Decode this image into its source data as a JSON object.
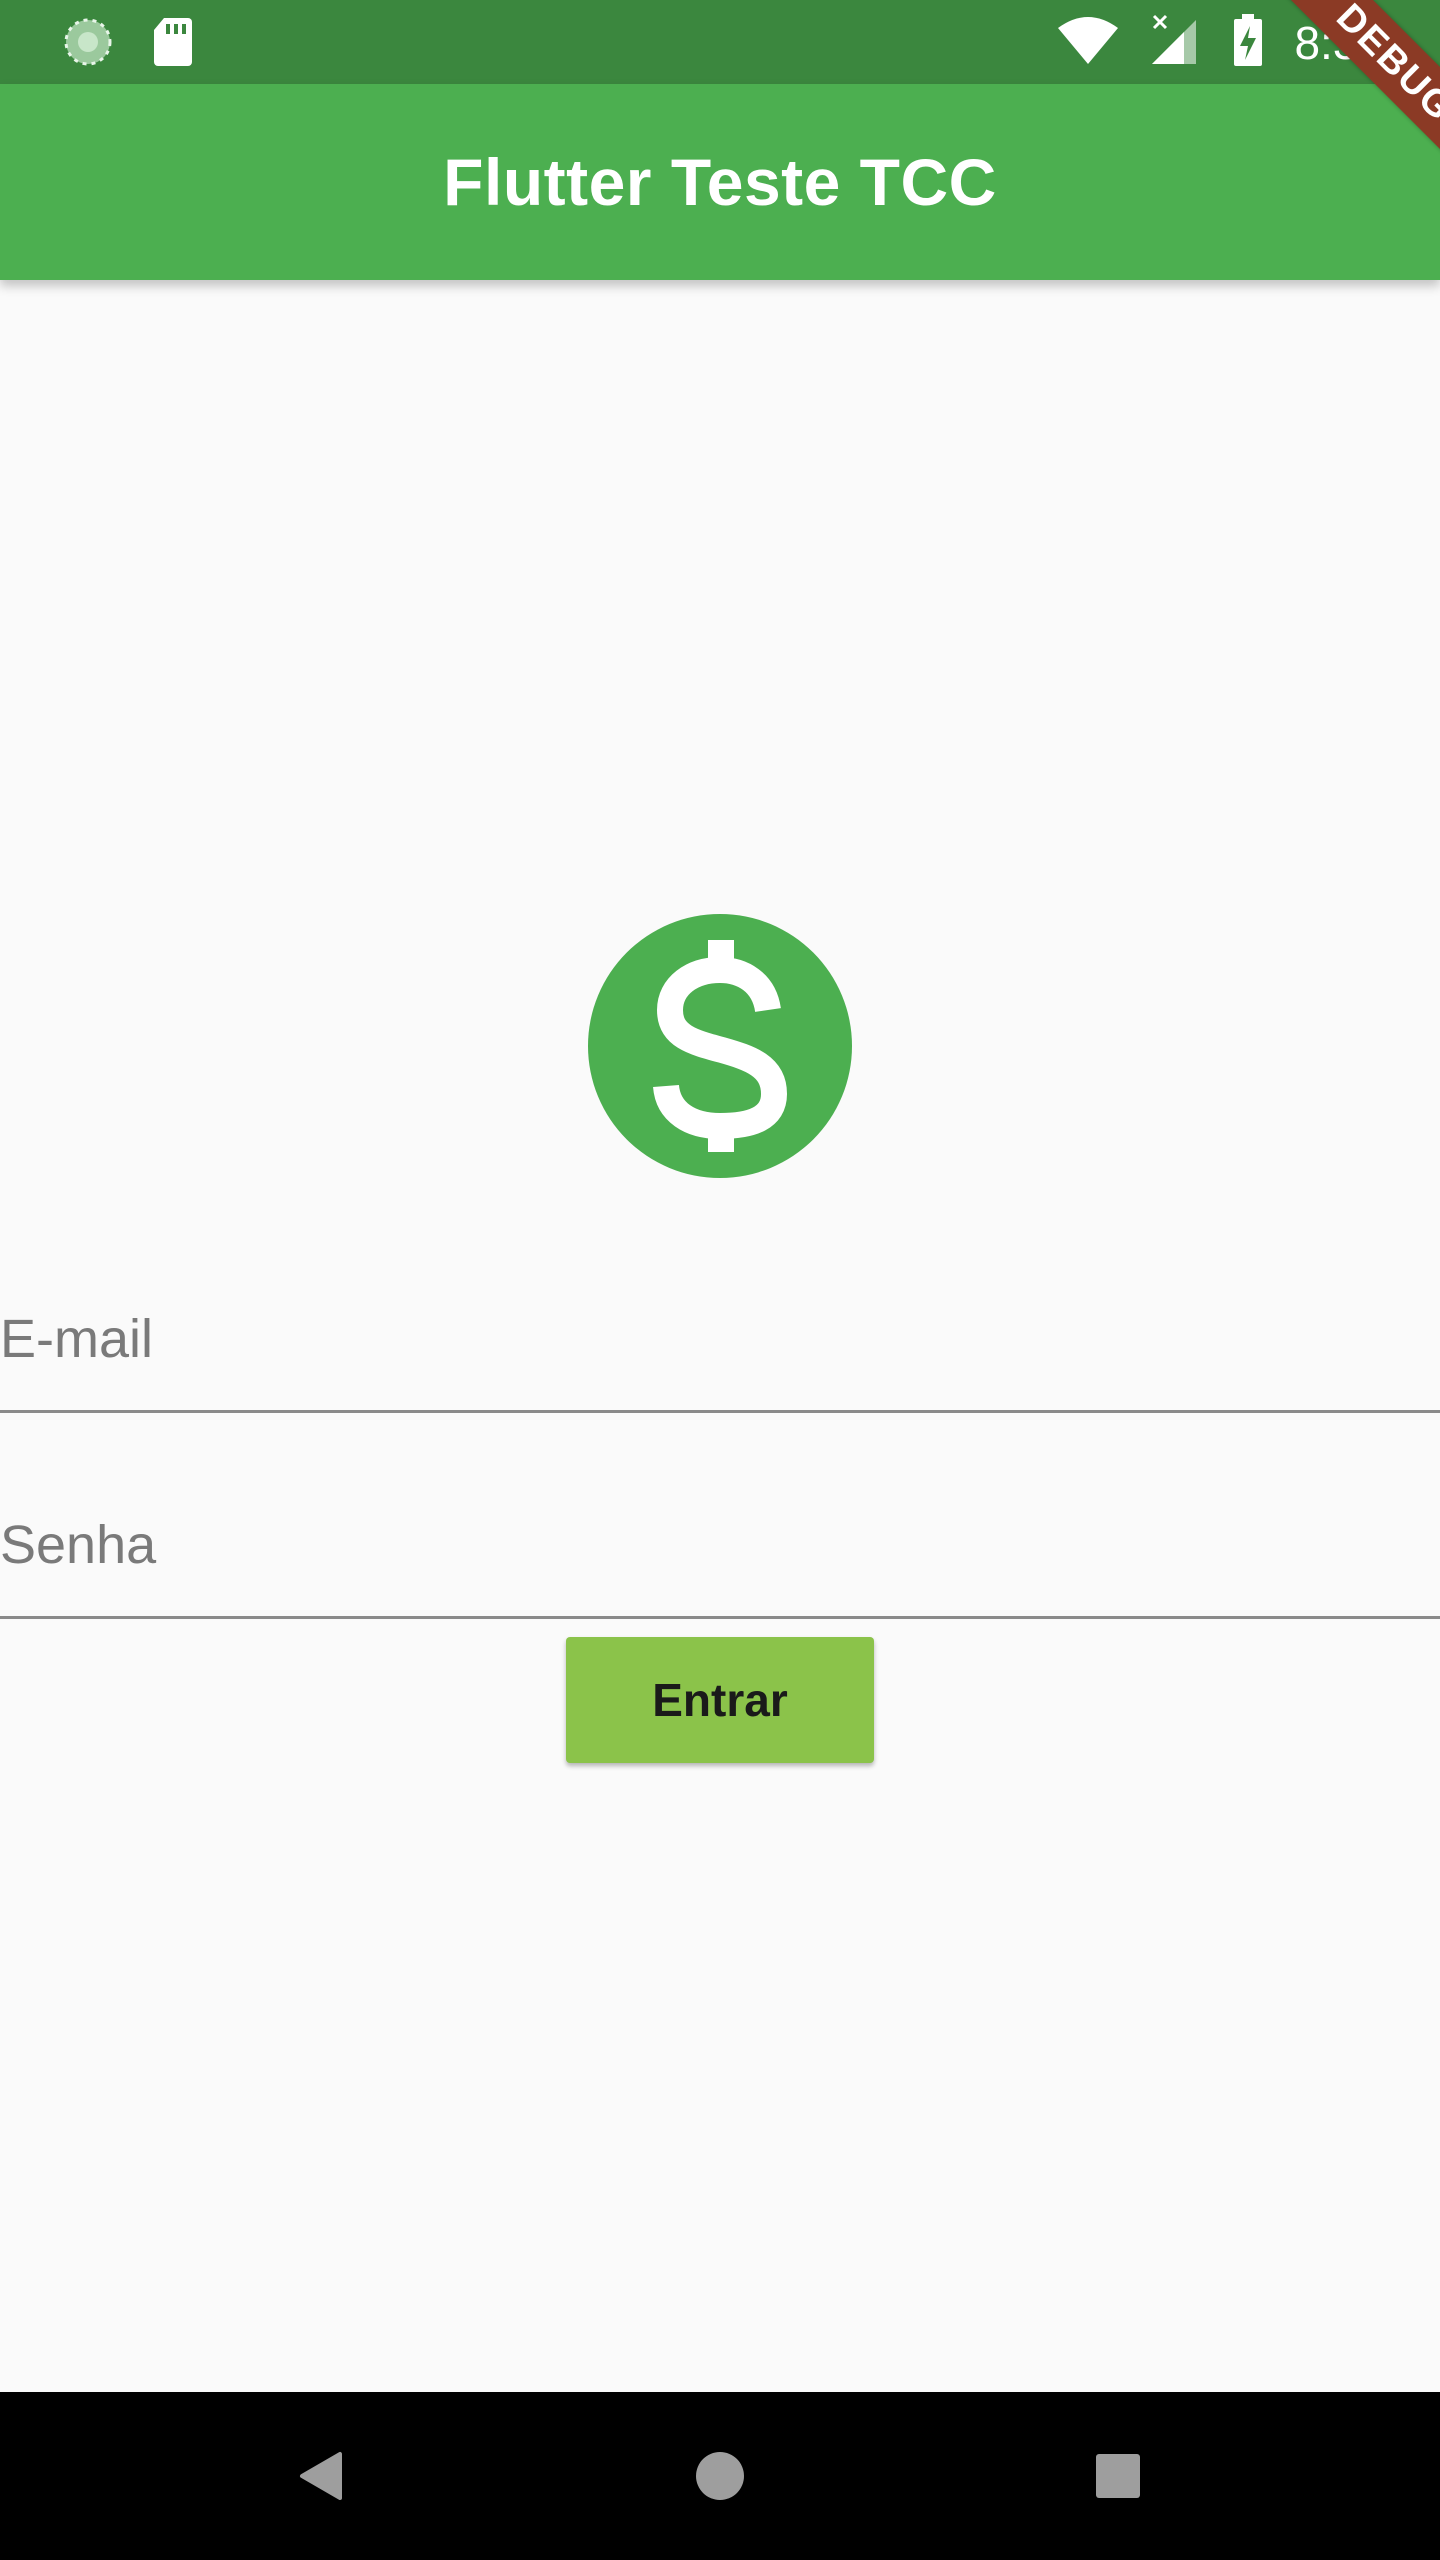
{
  "status_bar": {
    "time": "8:36",
    "icons": [
      "sync-icon",
      "sd-card-icon",
      "wifi-icon",
      "cell-signal-icon",
      "battery-charging-icon"
    ]
  },
  "app_bar": {
    "title": "Flutter Teste TCC",
    "color": "#4caf50"
  },
  "debug_banner": {
    "label": "DEBUG"
  },
  "logo": {
    "icon": "dollar-icon",
    "symbol": "$",
    "color": "#4caf50"
  },
  "form": {
    "email": {
      "value": "",
      "placeholder": "E-mail"
    },
    "password": {
      "value": "",
      "placeholder": "Senha"
    },
    "submit_label": "Entrar",
    "button_color": "#8bc34a"
  },
  "nav_bar": {
    "icons": [
      "back-icon",
      "home-icon",
      "recents-icon"
    ]
  }
}
